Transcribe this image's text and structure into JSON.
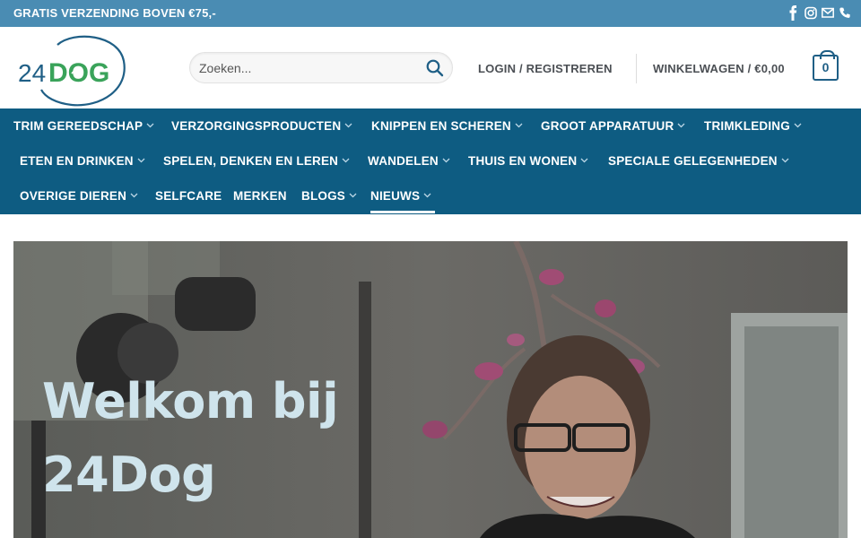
{
  "topbar": {
    "promo": "GRATIS VERZENDING BOVEN €75,-",
    "social_icons": [
      "facebook-icon",
      "instagram-icon",
      "email-icon",
      "phone-icon"
    ]
  },
  "header": {
    "logo_text": "24DOG",
    "search": {
      "placeholder": "Zoeken...",
      "value": ""
    },
    "login_label": "LOGIN / REGISTREREN",
    "cart_label": "WINKELWAGEN / €0,00",
    "cart_count": "0"
  },
  "nav": {
    "items": [
      {
        "label": "TRIM GEREEDSCHAP",
        "dropdown": true
      },
      {
        "label": "VERZORGINGSPRODUCTEN",
        "dropdown": true
      },
      {
        "label": "KNIPPEN EN SCHEREN",
        "dropdown": true
      },
      {
        "label": "GROOT APPARATUUR",
        "dropdown": true
      },
      {
        "label": "TRIMKLEDING",
        "dropdown": true
      },
      {
        "label": "ETEN EN DRINKEN",
        "dropdown": true
      },
      {
        "label": "SPELEN, DENKEN EN LEREN",
        "dropdown": true
      },
      {
        "label": "WANDELEN",
        "dropdown": true
      },
      {
        "label": "THUIS EN WONEN",
        "dropdown": true
      },
      {
        "label": "SPECIALE GELEGENHEDEN",
        "dropdown": true
      },
      {
        "label": "OVERIGE DIEREN",
        "dropdown": true
      },
      {
        "label": "SELFCARE",
        "dropdown": false
      },
      {
        "label": "MERKEN",
        "dropdown": false
      },
      {
        "label": "BLOGS",
        "dropdown": true
      },
      {
        "label": "NIEUWS",
        "dropdown": true,
        "active": true
      }
    ]
  },
  "hero": {
    "heading_line1": "Welkom bij",
    "heading_line2": "24Dog"
  },
  "colors": {
    "topbar": "#4a8cb3",
    "nav": "#0e5c82",
    "logo_blue": "#1f5f86",
    "logo_green": "#3aa35a",
    "hero_text": "#cfe4ec"
  }
}
